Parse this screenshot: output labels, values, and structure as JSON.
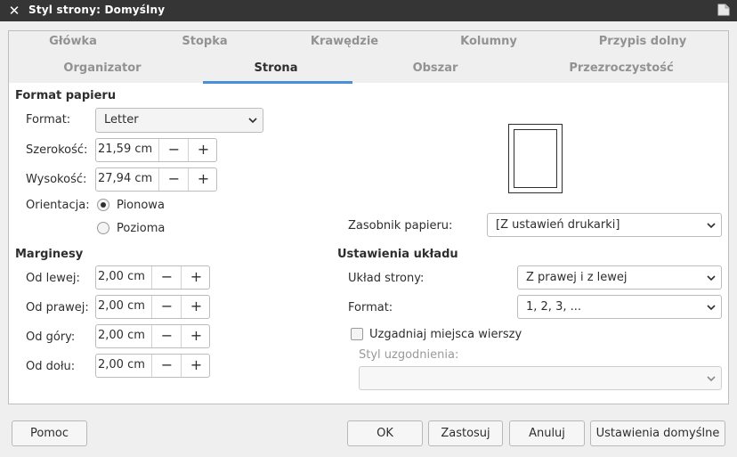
{
  "window": {
    "title": "Styl strony: Domyślny",
    "close_glyph": "✕"
  },
  "tabs": {
    "row1": [
      "Główka",
      "Stopka",
      "Krawędzie",
      "Kolumny",
      "Przypis dolny"
    ],
    "row2": [
      "Organizator",
      "Strona",
      "Obszar",
      "Przezroczystość"
    ],
    "active": "Strona"
  },
  "paper_format": {
    "section_title": "Format papieru",
    "format_label": "Format:",
    "format_value": "Letter",
    "width_label": "Szerokość:",
    "width_value": "21,59 cm",
    "height_label": "Wysokość:",
    "height_value": "27,94 cm",
    "orientation_label": "Orientacja:",
    "portrait_label": "Pionowa",
    "landscape_label": "Pozioma",
    "orientation_selected": "Pionowa",
    "tray_label": "Zasobnik papieru:",
    "tray_value": "[Z ustawień drukarki]"
  },
  "margins": {
    "section_title": "Marginesy",
    "left_label": "Od lewej:",
    "left_value": "2,00 cm",
    "right_label": "Od prawej:",
    "right_value": "2,00 cm",
    "top_label": "Od góry:",
    "top_value": "2,00 cm",
    "bottom_label": "Od dołu:",
    "bottom_value": "2,00 cm"
  },
  "layout": {
    "section_title": "Ustawienia układu",
    "page_layout_label": "Układ strony:",
    "page_layout_value": "Z prawej i z lewej",
    "format_label": "Format:",
    "format_value": "1, 2, 3, ...",
    "register_label": "Uzgadniaj miejsca wierszy",
    "register_checked": false,
    "reference_style_label": "Styl uzgodnienia:",
    "reference_style_value": ""
  },
  "spin": {
    "minus": "−",
    "plus": "+"
  },
  "buttons": {
    "help": "Pomoc",
    "ok": "OK",
    "apply": "Zastosuj",
    "cancel": "Anuluj",
    "reset": "Ustawienia domyślne"
  },
  "colors": {
    "titlebar": "#353535",
    "accent": "#4a90d9"
  }
}
